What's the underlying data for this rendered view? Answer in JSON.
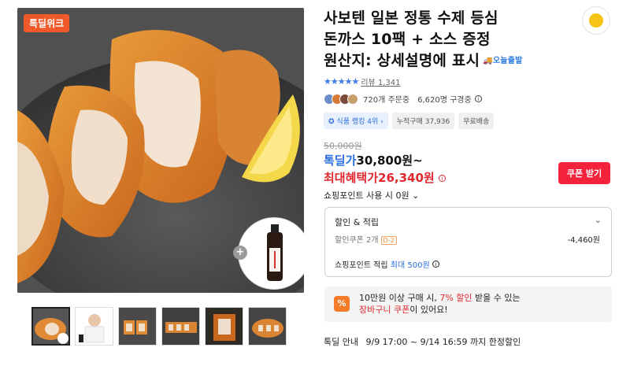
{
  "gallery": {
    "badge": "톡딜위크",
    "thumbnails": [
      "thumb-1",
      "thumb-2",
      "thumb-3",
      "thumb-4",
      "thumb-5",
      "thumb-6"
    ]
  },
  "product": {
    "title_line1": "사보텐 일본 정통 수제 등심",
    "title_line2": "돈까스 10팩 + 소스 증정",
    "title_line3": "원산지: 상세설명에 표시",
    "today_delivery": "오늘출발",
    "stars": "★★★★★",
    "review_label": "리뷰",
    "review_count": "1,341",
    "orders_label": "720개 주문중",
    "subscribers_label": "6,620명 구경중",
    "tag_rank": "식품 랭킹 4위",
    "tag_cumulative": "누적구매 37,936",
    "tag_shipping": "무료배송"
  },
  "price": {
    "original": "50,000원",
    "deal_label": "톡딜가",
    "deal_value": "30,800원~",
    "max_label": "최대혜택가",
    "max_value": "26,340원",
    "coupon_button": "쿠폰 받기",
    "points_use": "쇼핑포인트 사용 시",
    "points_use_value": "0원"
  },
  "discount": {
    "title": "할인 & 적립",
    "coupon_label": "할인쿠폰 2개",
    "coupon_badge": "D-2",
    "coupon_amount": "-4,460원",
    "points_label": "쇼핑포인트 적립",
    "points_prefix": "최대",
    "points_value": "500원"
  },
  "promo": {
    "icon": "%",
    "line1_a": "10만원 이상 구매 시,",
    "line1_pct": "7% 할인",
    "line1_b": "받을 수 있는",
    "line2_a": "장바구니 쿠폰",
    "line2_b": "이 있어요!"
  },
  "deal_info": {
    "label": "톡딜 안내",
    "period": "9/9 17:00 ~ 9/14 16:59 까지 한정할인"
  },
  "colors": {
    "accent_blue": "#2a6ee0",
    "accent_red": "#e0282f",
    "coupon_button": "#f2233b",
    "badge_orange": "#f05a2a"
  }
}
